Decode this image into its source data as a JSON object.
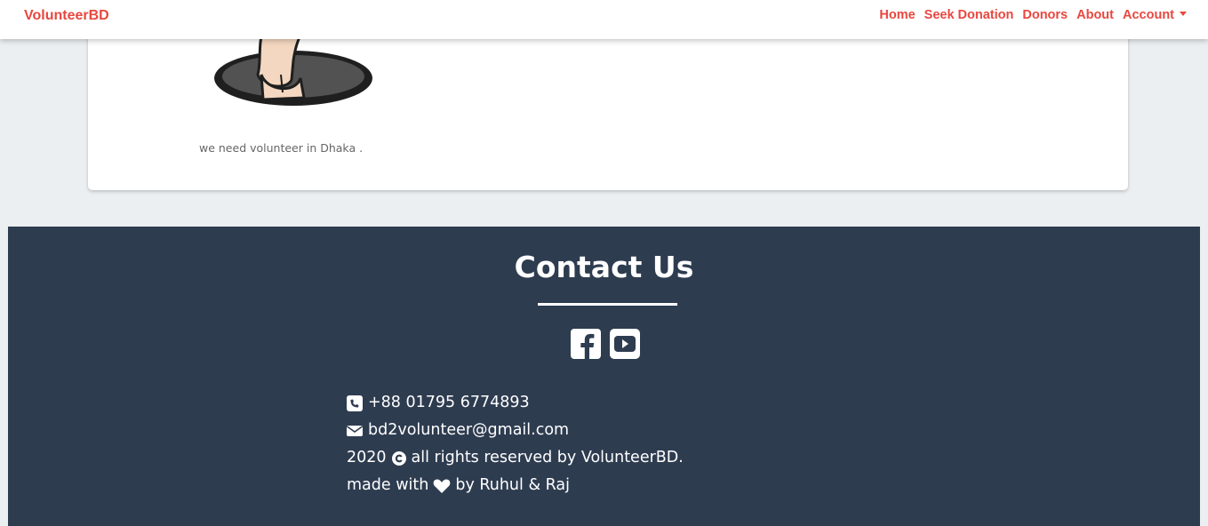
{
  "navbar": {
    "brand": "VolunteerBD",
    "links": [
      "Home",
      "Seek Donation",
      "Donors",
      "About",
      "Account"
    ]
  },
  "card": {
    "text": "we need volunteer in Dhaka ."
  },
  "footer": {
    "title": "Contact Us",
    "social": [
      "facebook-icon",
      "youtube-icon"
    ],
    "phone": "+88 01795 6774893",
    "email": "bd2volunteer@gmail.com",
    "copyright_year": "2020",
    "copyright_text": "all rights reserved by VolunteerBD.",
    "made_with_prefix": "made with",
    "made_with_suffix": "by Ruhul & Raj"
  },
  "colors": {
    "brand": "#e8473f",
    "footer_bg": "#2e3c50",
    "page_bg": "#eceff1"
  }
}
